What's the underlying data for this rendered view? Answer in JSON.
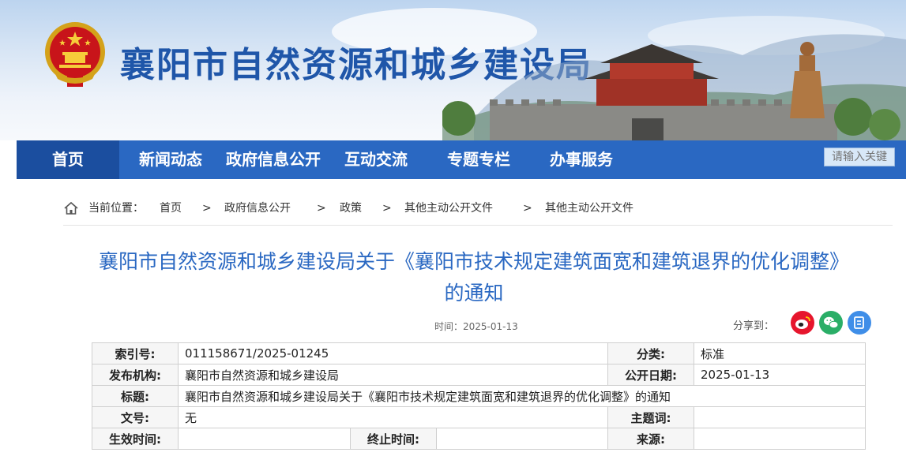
{
  "site": {
    "title": "襄阳市自然资源和城乡建设局"
  },
  "nav": {
    "items": [
      {
        "label": "首页"
      },
      {
        "label": "新闻动态"
      },
      {
        "label": "政府信息公开"
      },
      {
        "label": "互动交流"
      },
      {
        "label": "专题专栏"
      },
      {
        "label": "办事服务"
      }
    ],
    "search_placeholder": "请输入关键"
  },
  "breadcrumb": {
    "prefix": "当前位置：",
    "items": [
      "首页",
      "政府信息公开",
      "政策",
      "其他主动公开文件",
      "其他主动公开文件"
    ],
    "separator": ">"
  },
  "article": {
    "title_line1": "襄阳市自然资源和城乡建设局关于《襄阳市技术规定建筑面宽和建筑退界的优化调整》",
    "title_line2": "的通知",
    "time": "时间：2025-01-13",
    "share_label": "分享到："
  },
  "share": {
    "icons": [
      "weibo-icon",
      "wechat-icon",
      "copy-icon"
    ],
    "colors": {
      "weibo": "#e6162d",
      "wechat": "#2aae67",
      "copy": "#3f8ee8"
    }
  },
  "meta": {
    "index_key": "索引号:",
    "index_val": "011158671/2025-01245",
    "category_key": "分类:",
    "category_val": "标准",
    "publisher_key": "发布机构:",
    "publisher_val": "襄阳市自然资源和城乡建设局",
    "date_key": "公开日期:",
    "date_val": "2025-01-13",
    "title_key": "标题:",
    "title_val": "襄阳市自然资源和城乡建设局关于《襄阳市技术规定建筑面宽和建筑退界的优化调整》的通知",
    "docno_key": "文号:",
    "docno_val": "无",
    "subject_key": "主题词:",
    "subject_val": "",
    "effective_key": "生效时间:",
    "effective_val": "",
    "expire_key": "终止时间:",
    "expire_val": "",
    "source_key": "来源:",
    "source_val": ""
  },
  "colors": {
    "nav_bg": "#2a68c2",
    "nav_active": "#1b4e9f",
    "title_blue": "#2a68c2",
    "site_title": "#1f56a9"
  }
}
